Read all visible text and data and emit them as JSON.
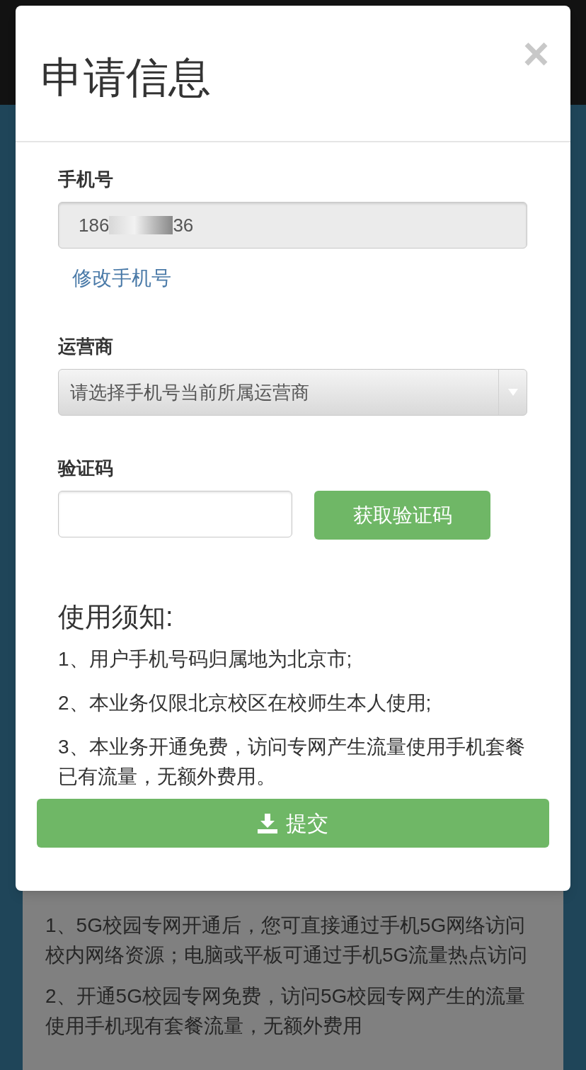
{
  "modal": {
    "title": "申请信息",
    "close": "×",
    "fields": [
      {
        "kind": "readonly",
        "label": "手机号",
        "value_start": "186",
        "value_end": "36",
        "link": "修改手机号"
      },
      {
        "kind": "select",
        "label": "运营商",
        "placeholder": "请选择手机号当前所属运营商"
      },
      {
        "kind": "code",
        "label": "验证码",
        "button": "获取验证码"
      }
    ],
    "notice": {
      "title": "使用须知:",
      "items": [
        "1、用户手机号码归属地为北京市;",
        "2、本业务仅限北京校区在校师生本人使用;",
        "3、本业务开通免费，访问专网产生流量使用手机套餐已有流量，无额外费用。"
      ]
    },
    "submit": "提交"
  },
  "background": {
    "items": [
      "1、5G校园专网开通后，您可直接通过手机5G网络访问校内网络资源；电脑或平板可通过手机5G流量热点访问",
      "2、开通5G校园专网免费，访问5G校园专网产生的流量使用手机现有套餐流量，无额外费用"
    ]
  }
}
